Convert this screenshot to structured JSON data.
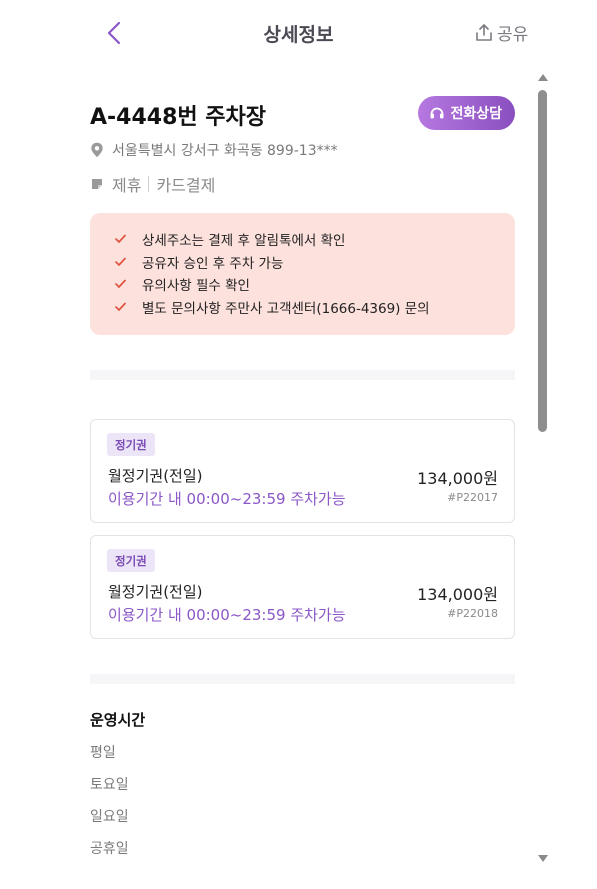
{
  "header": {
    "title": "상세정보",
    "share_label": "공유"
  },
  "lot": {
    "title": "A-4448번 주차장",
    "call_label": "전화상담",
    "address": "서울특별시 강서구 화곡동 899-13***",
    "tags": [
      "제휴",
      "카드결제"
    ]
  },
  "notices": [
    "상세주소는 결제 후 알림톡에서 확인",
    "공유자 승인 후 주차 가능",
    "유의사항 필수 확인",
    "별도 문의사항 주만사 고객센터(1666-4369) 문의"
  ],
  "tickets": [
    {
      "badge": "정기권",
      "name": "월정기권(전일)",
      "price": "134,000원",
      "desc": "이용기간 내 00:00~23:59 주차가능",
      "code": "#P22017"
    },
    {
      "badge": "정기권",
      "name": "월정기권(전일)",
      "price": "134,000원",
      "desc": "이용기간 내 00:00~23:59 주차가능",
      "code": "#P22018"
    }
  ],
  "hours": {
    "title": "운영시간",
    "days": [
      "평일",
      "토요일",
      "일요일",
      "공휴일"
    ]
  },
  "colors": {
    "accent": "#8b57c7",
    "notice_bg": "#fde1dd",
    "check": "#e0533f",
    "badge_bg": "#ece4f7"
  },
  "icons": [
    "chevron-left-icon",
    "share-icon",
    "headset-icon",
    "location-pin-icon",
    "partner-tag-icon",
    "check-icon"
  ]
}
